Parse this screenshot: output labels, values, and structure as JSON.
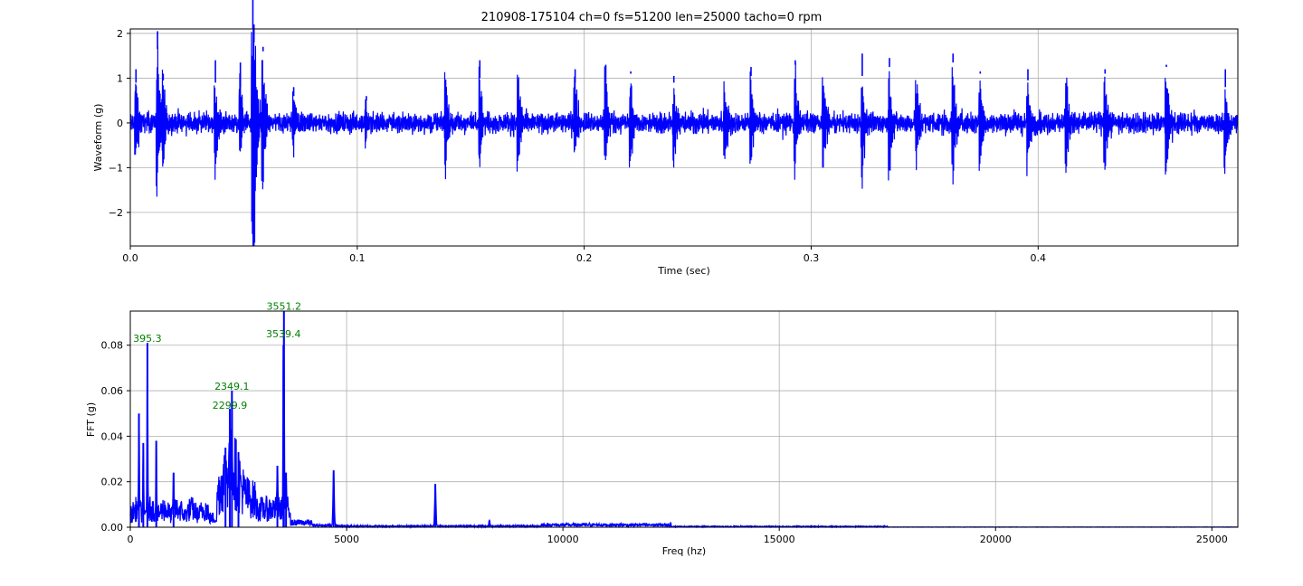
{
  "title": "210908-175104 ch=0 fs=51200 len=25000 tacho=0 rpm",
  "colors": {
    "line": "#0000ff",
    "peak": "#008000",
    "grid": "#b0b0b0"
  },
  "chart_data": [
    {
      "type": "line",
      "name": "waveform",
      "xlabel": "Time (sec)",
      "ylabel": "Waveform (g)",
      "xlim": [
        0.0,
        0.488
      ],
      "ylim": [
        -2.75,
        2.1
      ],
      "xticks": [
        0.0,
        0.1,
        0.2,
        0.3,
        0.4
      ],
      "xtick_labels": [
        "0.0",
        "0.1",
        "0.2",
        "0.3",
        "0.4"
      ],
      "yticks": [
        2,
        1,
        0,
        -1,
        -2
      ],
      "ytick_labels": [
        "2",
        "1",
        "0",
        "−1",
        "−2"
      ],
      "grid": true,
      "impulses": [
        {
          "t": 0.0025,
          "hi": 1.2,
          "lo": -0.9
        },
        {
          "t": 0.012,
          "hi": 2.05,
          "lo": -1.65
        },
        {
          "t": 0.0145,
          "hi": 0.95,
          "lo": -1.1
        },
        {
          "t": 0.0375,
          "hi": 0.9,
          "lo": -1.4
        },
        {
          "t": 0.0485,
          "hi": 1.35,
          "lo": -0.8
        },
        {
          "t": 0.054,
          "hi": 2.1,
          "lo": -2.75
        },
        {
          "t": 0.0545,
          "hi": 1.8,
          "lo": -2.2
        },
        {
          "t": 0.0585,
          "hi": 1.6,
          "lo": -1.7
        },
        {
          "t": 0.072,
          "hi": 0.8,
          "lo": -0.6
        },
        {
          "t": 0.104,
          "hi": 0.6,
          "lo": -0.5
        },
        {
          "t": 0.139,
          "hi": 1.2,
          "lo": -1.2
        },
        {
          "t": 0.154,
          "hi": 1.4,
          "lo": -1.0
        },
        {
          "t": 0.171,
          "hi": 1.25,
          "lo": -1.25
        },
        {
          "t": 0.196,
          "hi": 1.2,
          "lo": -0.9
        },
        {
          "t": 0.2095,
          "hi": 1.3,
          "lo": -0.9
        },
        {
          "t": 0.2205,
          "hi": 1.1,
          "lo": -1.15
        },
        {
          "t": 0.2395,
          "hi": 0.9,
          "lo": -1.05
        },
        {
          "t": 0.262,
          "hi": 1.0,
          "lo": -1.0
        },
        {
          "t": 0.2735,
          "hi": 1.25,
          "lo": -1.05
        },
        {
          "t": 0.293,
          "hi": 1.4,
          "lo": -1.3
        },
        {
          "t": 0.3055,
          "hi": 1.1,
          "lo": -1.1
        },
        {
          "t": 0.3225,
          "hi": 1.05,
          "lo": -1.55
        },
        {
          "t": 0.3345,
          "hi": 1.25,
          "lo": -1.45
        },
        {
          "t": 0.3465,
          "hi": 1.1,
          "lo": -1.1
        },
        {
          "t": 0.3625,
          "hi": 1.35,
          "lo": -1.55
        },
        {
          "t": 0.3745,
          "hi": 1.1,
          "lo": -1.15
        },
        {
          "t": 0.3955,
          "hi": 0.95,
          "lo": -1.2
        },
        {
          "t": 0.4125,
          "hi": 1.25,
          "lo": -1.25
        },
        {
          "t": 0.4295,
          "hi": 1.1,
          "lo": -1.2
        },
        {
          "t": 0.4565,
          "hi": 1.25,
          "lo": -1.3
        },
        {
          "t": 0.4825,
          "hi": 0.8,
          "lo": -1.2
        }
      ]
    },
    {
      "type": "line",
      "name": "fft",
      "xlabel": "Freq (hz)",
      "ylabel": "FFT (g)",
      "xlim": [
        0,
        25600
      ],
      "ylim": [
        0.0,
        0.095
      ],
      "xticks": [
        0,
        5000,
        10000,
        15000,
        20000,
        25000
      ],
      "xtick_labels": [
        "0",
        "5000",
        "10000",
        "15000",
        "20000",
        "25000"
      ],
      "yticks": [
        0.0,
        0.02,
        0.04,
        0.06,
        0.08
      ],
      "ytick_labels": [
        "0.00",
        "0.02",
        "0.04",
        "0.06",
        "0.08"
      ],
      "grid": true,
      "peaks": [
        {
          "f": 200,
          "a": 0.05
        },
        {
          "f": 300,
          "a": 0.037
        },
        {
          "f": 395.3,
          "a": 0.081
        },
        {
          "f": 600,
          "a": 0.038
        },
        {
          "f": 1000,
          "a": 0.024
        },
        {
          "f": 2200,
          "a": 0.035
        },
        {
          "f": 2299.9,
          "a": 0.052
        },
        {
          "f": 2349.1,
          "a": 0.06
        },
        {
          "f": 2500,
          "a": 0.033
        },
        {
          "f": 3400,
          "a": 0.027
        },
        {
          "f": 3539.4,
          "a": 0.08
        },
        {
          "f": 3551.2,
          "a": 0.095
        },
        {
          "f": 3600,
          "a": 0.024
        },
        {
          "f": 4700,
          "a": 0.025
        },
        {
          "f": 7050,
          "a": 0.019
        },
        {
          "f": 8300,
          "a": 0.003
        }
      ],
      "annotations": [
        {
          "label": "3551.2",
          "f": 3551.2,
          "a": 0.0955
        },
        {
          "label": "395.3",
          "f": 395.3,
          "a": 0.0815
        },
        {
          "label": "3539.4",
          "f": 3539.4,
          "a": 0.0835
        },
        {
          "label": "2349.1",
          "f": 2349.1,
          "a": 0.0605
        },
        {
          "label": "2299.9",
          "f": 2299.9,
          "a": 0.052
        }
      ]
    }
  ]
}
